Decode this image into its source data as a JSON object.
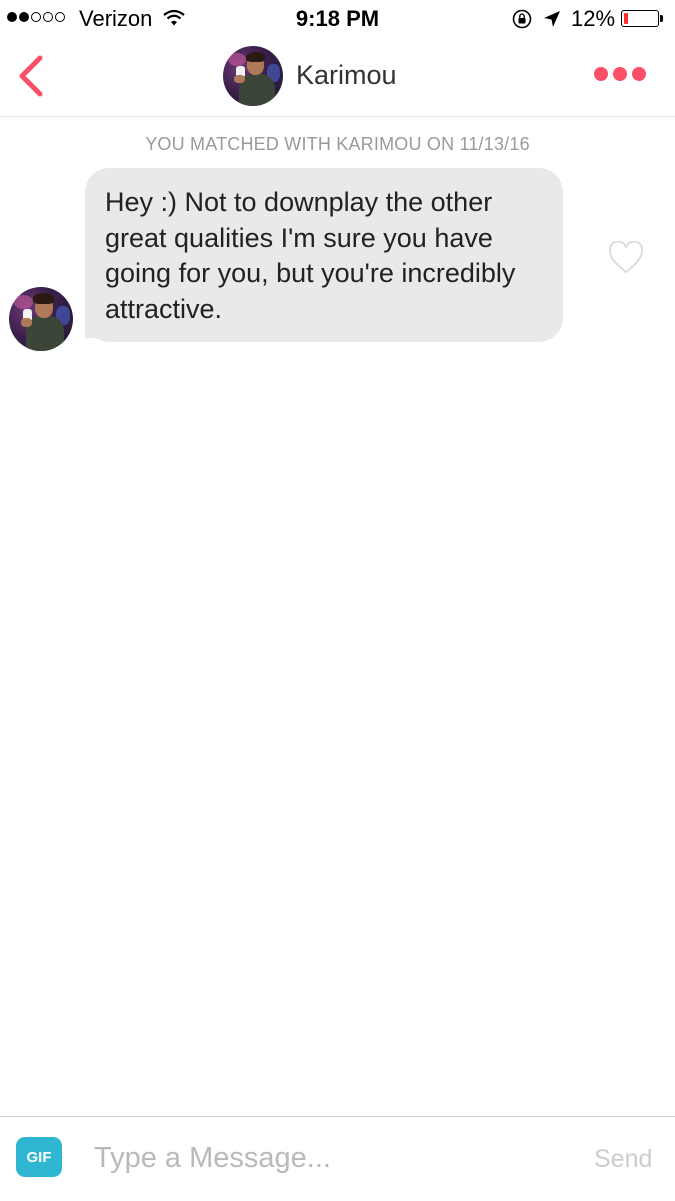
{
  "status_bar": {
    "carrier": "Verizon",
    "time": "9:18 PM",
    "battery_percent": "12%",
    "battery_level": 0.12,
    "signal_bars_filled": 2,
    "signal_bars_total": 5
  },
  "header": {
    "contact_name": "Karimou"
  },
  "conversation": {
    "match_note": "YOU MATCHED WITH KARIMOU ON 11/13/16",
    "messages": [
      {
        "text": "Hey :) Not to downplay the other great qualities I'm sure you have going for you, but you're incredibly attractive.",
        "liked": false
      }
    ]
  },
  "composer": {
    "gif_label": "GIF",
    "placeholder": "Type a Message...",
    "value": "",
    "send_label": "Send"
  },
  "colors": {
    "accent": "#fd4f68",
    "bubble": "#e9e9ea",
    "gif_button": "#2fb6d0",
    "battery_low": "#ff2d2d"
  },
  "icons": {
    "back": "chevron-left-icon",
    "more": "more-dots-icon",
    "like": "heart-outline-icon",
    "wifi": "wifi-icon",
    "rotation_lock": "rotation-lock-icon",
    "location": "location-arrow-icon"
  }
}
